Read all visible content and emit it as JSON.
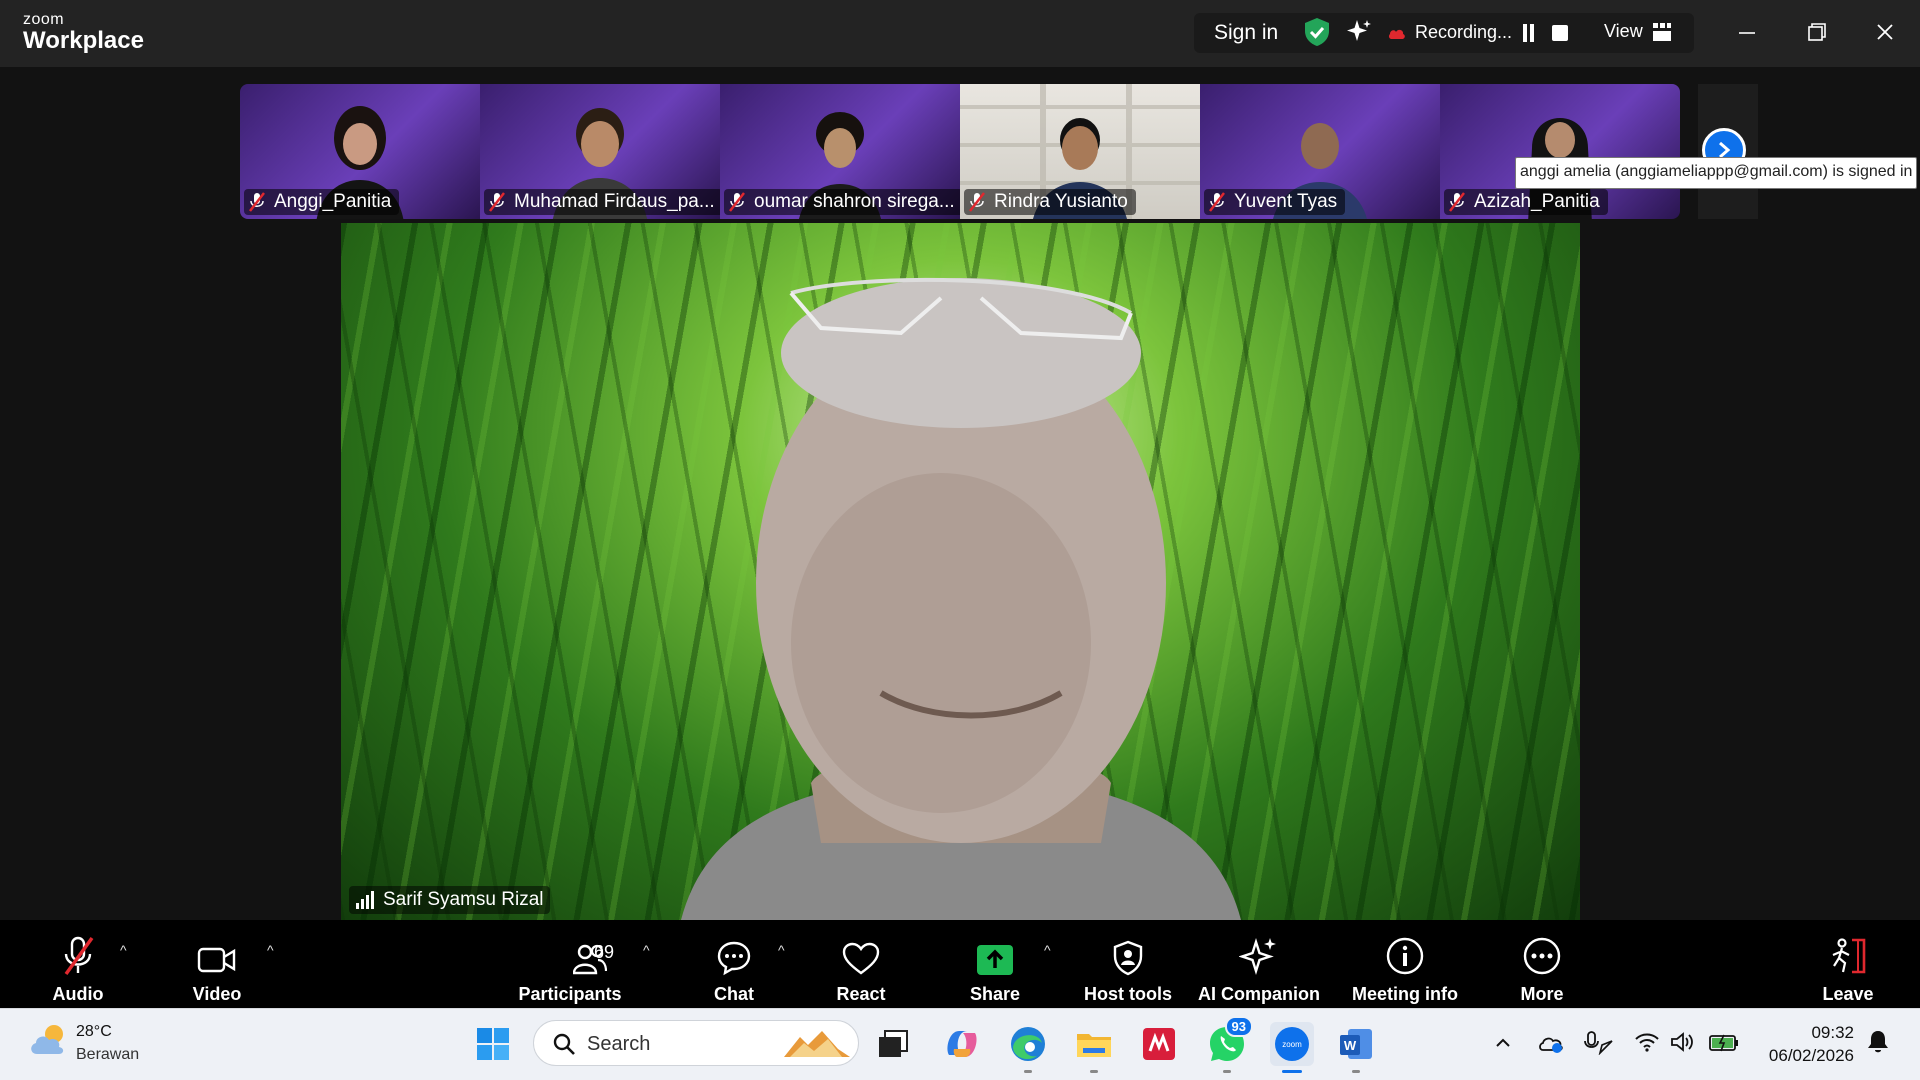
{
  "app": {
    "logo_line1": "zoom",
    "logo_line2": "Workplace"
  },
  "titlebar": {
    "sign_in": "Sign in",
    "recording": "Recording...",
    "view": "View"
  },
  "colors": {
    "accent": "#0e71eb",
    "shield": "#23a559",
    "share": "#1db954",
    "mute": "#e0282e"
  },
  "gallery": {
    "participants": [
      {
        "name": "Anggi_Panitia",
        "muted": true
      },
      {
        "name": "Muhamad Firdaus_pa...",
        "muted": true
      },
      {
        "name": "oumar shahron sirega...",
        "muted": true
      },
      {
        "name": "Rindra Yusianto",
        "muted": true
      },
      {
        "name": "Yuvent Tyas",
        "muted": true
      },
      {
        "name": "Azizah_Panitia",
        "muted": true
      }
    ],
    "tooltip": "anggi amelia (anggiameliappp@gmail.com) is signed in"
  },
  "main": {
    "speaker_name": "Sarif Syamsu Rizal"
  },
  "toolbar": {
    "audio": "Audio",
    "video": "Video",
    "participants": "Participants",
    "participants_count": "69",
    "chat": "Chat",
    "react": "React",
    "share": "Share",
    "host_tools": "Host tools",
    "ai_companion": "AI Companion",
    "meeting_info": "Meeting info",
    "more": "More",
    "leave": "Leave"
  },
  "taskbar": {
    "weather_temp": "28°C",
    "weather_desc": "Berawan",
    "search_placeholder": "Search",
    "whatsapp_badge": "93",
    "time": "09:32",
    "date": "06/02/2026"
  }
}
